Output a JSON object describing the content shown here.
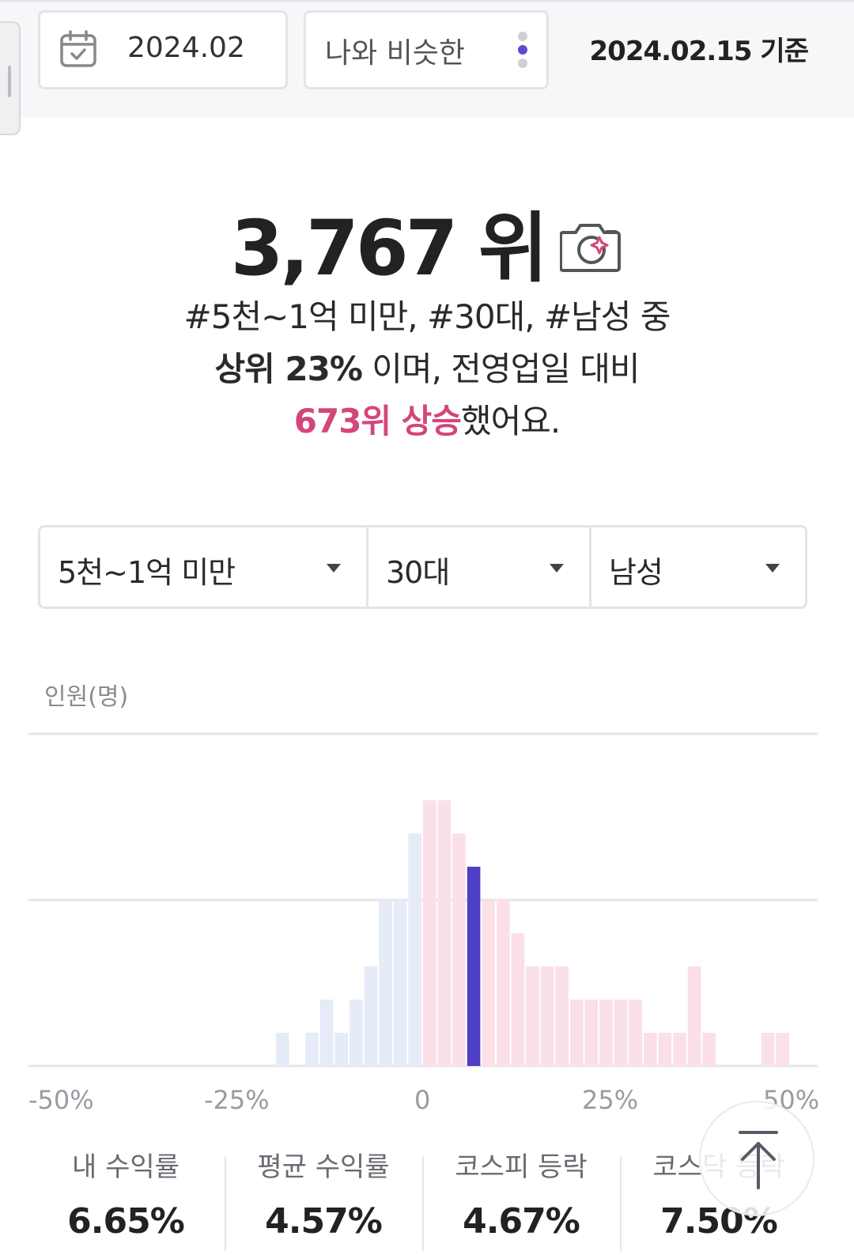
{
  "header": {
    "date_label": "2024.02",
    "peer_group_label": "나와 비슷한",
    "basis_label": "2024.02.15 기준"
  },
  "rank": {
    "value": "3,767 위"
  },
  "summary": {
    "line1": "#5천~1억 미만, #30대, #남성 중",
    "line2_strong": "상위 23%",
    "line2_rest": " 이며, 전영업일 대비",
    "line3_pink": "673위 상승",
    "line3_rest": "했어요."
  },
  "filters": {
    "asset": "5천~1억 미만",
    "age": "30대",
    "gender": "남성"
  },
  "chart_data": {
    "type": "bar",
    "ylabel": "인원(명)",
    "x_tick_labels": [
      "-50%",
      "-25%",
      "0",
      "25%",
      "50%"
    ],
    "xlim": [
      -50,
      50
    ],
    "bin_width": 2,
    "bin_starts": [
      -20,
      -18,
      -16,
      -14,
      -12,
      -10,
      -8,
      -6,
      -4,
      -2,
      0,
      2,
      4,
      6,
      8,
      10,
      12,
      14,
      16,
      18,
      20,
      22,
      24,
      26,
      28,
      30,
      32,
      34,
      36,
      38,
      40,
      42,
      44,
      46,
      48
    ],
    "values": [
      1,
      0,
      1,
      2,
      1,
      2,
      3,
      5,
      5,
      7,
      8,
      8,
      7,
      6,
      5,
      5,
      4,
      3,
      3,
      3,
      2,
      2,
      2,
      2,
      2,
      1,
      1,
      1,
      3,
      1,
      0,
      0,
      0,
      1,
      1
    ],
    "highlight_bin_start": 6,
    "colors": {
      "negative": "#e6ebf8",
      "positive": "#fbe0e8",
      "highlight": "#4f3fc4",
      "grid": "#e6e6ea"
    }
  },
  "stats": [
    {
      "label": "내 수익률",
      "value": "6.65%"
    },
    {
      "label": "평균 수익률",
      "value": "4.57%"
    },
    {
      "label": "코스피 등락",
      "value": "4.67%"
    },
    {
      "label": "코스닥 등락",
      "value": "7.50%"
    }
  ],
  "icons": {
    "calendar": "calendar-icon",
    "camera": "camera-sparkle-icon",
    "more": "more-vertical-icon",
    "scroll_top": "arrow-up-to-top-icon"
  }
}
